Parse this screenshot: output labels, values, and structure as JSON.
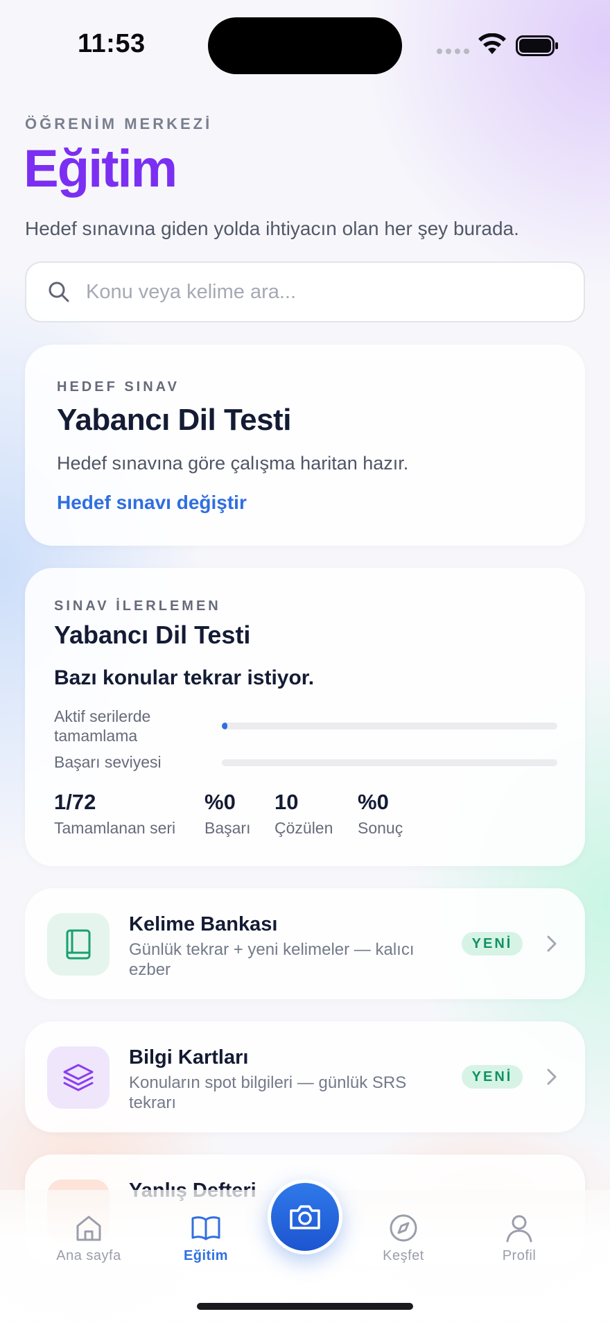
{
  "status_bar": {
    "time": "11:53"
  },
  "header": {
    "eyebrow": "ÖĞRENİM MERKEZİ",
    "title": "Eğitim",
    "subtitle": "Hedef sınavına giden yolda ihtiyacın olan her şey burada."
  },
  "search": {
    "placeholder": "Konu veya kelime ara...",
    "value": ""
  },
  "target_card": {
    "eyebrow": "HEDEF SINAV",
    "title": "Yabancı Dil Testi",
    "description": "Hedef sınavına göre çalışma haritan hazır.",
    "link": "Hedef sınavı değiştir"
  },
  "progress_card": {
    "eyebrow": "SINAV İLERLEMEN",
    "title": "Yabancı Dil Testi",
    "note": "Bazı konular tekrar istiyor.",
    "bars": [
      {
        "label": "Aktif serilerde tamamlama",
        "progress": 0.014
      },
      {
        "label": "Başarı seviyesi",
        "progress": 0
      }
    ],
    "stats": [
      {
        "value": "1/72",
        "label": "Tamamlanan seri"
      },
      {
        "value": "%0",
        "label": "Başarı"
      },
      {
        "value": "10",
        "label": "Çözülen"
      },
      {
        "value": "%0",
        "label": "Sonuç"
      }
    ]
  },
  "features": [
    {
      "title": "Kelime Bankası",
      "description": "Günlük tekrar + yeni kelimeler — kalıcı ezber",
      "badge": "YENİ",
      "icon": "book-icon",
      "icon_bg": "#e5f5ee",
      "icon_color": "#19a06e"
    },
    {
      "title": "Bilgi Kartları",
      "description": "Konuların spot bilgileri — günlük SRS tekrarı",
      "badge": "YENİ",
      "icon": "layers-icon",
      "icon_bg": "#efe6fc",
      "icon_color": "#8a3ff0"
    },
    {
      "title": "Yanlış Defteri"
    }
  ],
  "tab_bar": {
    "tabs": [
      {
        "label": "Ana sayfa",
        "icon": "home-icon"
      },
      {
        "label": "Eğitim",
        "icon": "open-book-icon",
        "active": true
      },
      {
        "label": "Keşfet",
        "icon": "compass-icon"
      },
      {
        "label": "Profil",
        "icon": "user-icon"
      }
    ],
    "center_action_icon": "camera-icon"
  },
  "colors": {
    "accent": "#7b2ff2",
    "link": "#2f6fe0",
    "badge_text": "#109264",
    "badge_bg": "#d7f3e6"
  }
}
